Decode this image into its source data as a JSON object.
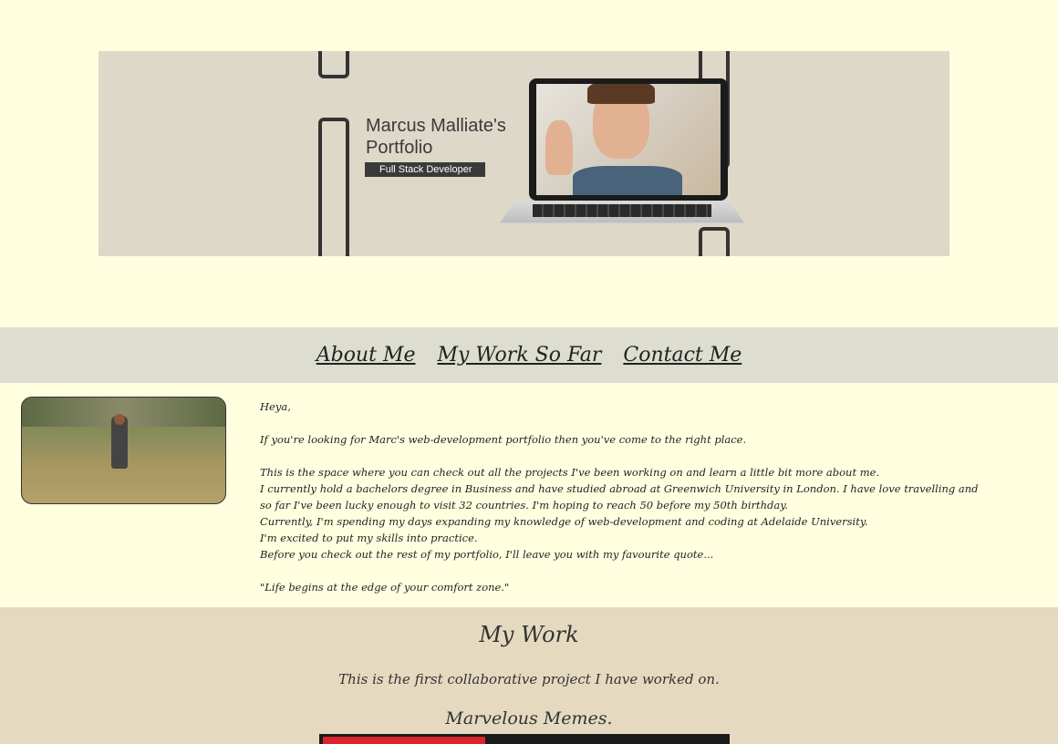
{
  "hero": {
    "title_line1": "Marcus Malliate's",
    "title_line2": "Portfolio",
    "badge": "Full Stack Developer"
  },
  "nav": {
    "items": [
      {
        "label": "About Me"
      },
      {
        "label": "My Work So Far"
      },
      {
        "label": "Contact Me"
      }
    ]
  },
  "about": {
    "greeting": "Heya,",
    "intro": "If you're looking for Marc's web-development portfolio then you've come to the right place.",
    "p1": "This is the space where you can check out all the projects I've been working on and learn a little bit more about me.",
    "p2": "I currently hold a bachelors degree in Business and have studied abroad at Greenwich University in London. I have love travelling and so far I've been lucky enough to visit 32 countries. I'm hoping to reach 50 before my 50th birthday.",
    "p3": "Currently, I'm spending my days expanding my knowledge of web-development and coding at Adelaide University.",
    "p4": "I'm excited to put my skills into practice.",
    "p5": "Before you check out the rest of my portfolio, I'll leave you with my favourite quote...",
    "quote": "\"Life begins at the edge of your comfort zone.\""
  },
  "work": {
    "heading": "My Work",
    "intro": "This is the first collaborative project I have worked on.",
    "project_title": "Marvelous Memes."
  },
  "colors": {
    "page_bg": "#ffffe0",
    "nav_bg": "#ddddd0",
    "work_bg": "#e5d9c0",
    "hero_bg": "#ddd8c8"
  }
}
